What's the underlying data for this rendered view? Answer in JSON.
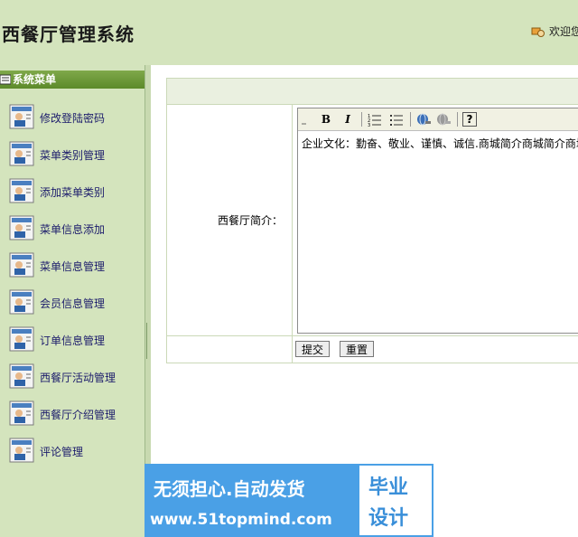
{
  "header": {
    "title": "西餐厅管理系统",
    "welcome": "欢迎您"
  },
  "sidebar": {
    "title": "系统菜单",
    "items": [
      {
        "label": "修改登陆密码"
      },
      {
        "label": "菜单类别管理"
      },
      {
        "label": "添加菜单类别"
      },
      {
        "label": "菜单信息添加"
      },
      {
        "label": "菜单信息管理"
      },
      {
        "label": "会员信息管理"
      },
      {
        "label": "订单信息管理"
      },
      {
        "label": "西餐厅活动管理"
      },
      {
        "label": "西餐厅介绍管理"
      },
      {
        "label": "评论管理"
      }
    ]
  },
  "form": {
    "field_label": "西餐厅简介：",
    "editor_content": "企业文化：勤奋、敬业、谨慎、诚信.商城简介商城简介商城",
    "toolbar": {
      "bold": "B",
      "italic": "I",
      "help": "?"
    },
    "submit_label": "提交",
    "reset_label": "重置"
  },
  "watermark": {
    "line1": "无须担心.自动发货",
    "line2": "www.51topmind.com",
    "badge_top": "毕业",
    "badge_bottom": "设计"
  },
  "colors": {
    "header_bg": "#d4e4bd",
    "sidebar_head": "#5c8a2a",
    "menu_text": "#1c1c6c",
    "watermark_bg": "#4aa0e6"
  }
}
